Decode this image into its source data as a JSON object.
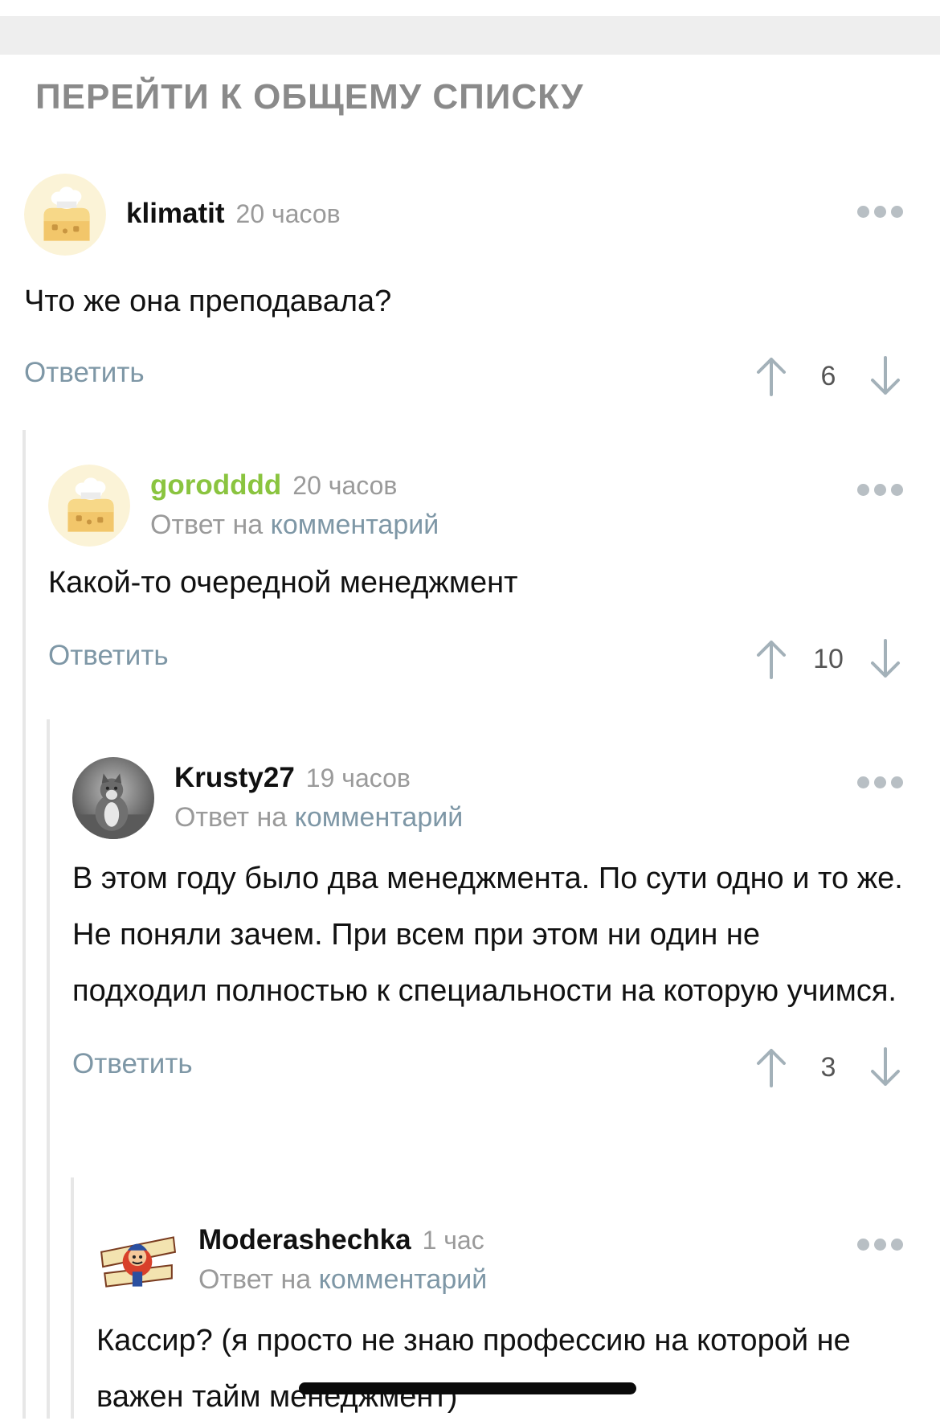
{
  "header": {
    "goto_all": "ПЕРЕЙТИ К ОБЩЕМУ СПИСКУ"
  },
  "comments": [
    {
      "author": "klimatit",
      "author_color": "#111111",
      "time": "20 часов",
      "avatar": "chef-hat-cheese-avatar",
      "text": "Что же она преподавала?",
      "reply_label": "Ответить",
      "rating": "6"
    },
    {
      "author": "gorodddd",
      "author_color": "#8ac43f",
      "time": "20 часов",
      "avatar": "chef-hat-cheese-avatar",
      "reply_to_prefix": "Ответ на",
      "reply_to_link": "комментарий",
      "text": "Какой-то очередной менеджмент",
      "reply_label": "Ответить",
      "rating": "10"
    },
    {
      "author": "Krusty27",
      "author_color": "#111111",
      "time": "19 часов",
      "avatar": "cat-photo-avatar",
      "reply_to_prefix": "Ответ на",
      "reply_to_link": "комментарий",
      "text": "В этом году было два менеджмента. По сути одно и то же. Не поняли зачем. При всем при этом ни один не подходил полностью к специальности на которую учимся.",
      "reply_label": "Ответить",
      "rating": "3"
    },
    {
      "author": "Moderashechka",
      "author_color": "#111111",
      "time": "1 час",
      "avatar": "cartoon-badge-avatar",
      "reply_to_prefix": "Ответ на",
      "reply_to_link": "комментарий",
      "text": "Кассир? (я просто не знаю профессию на которой не важен тайм менеджмент)"
    }
  ],
  "colors": {
    "link": "#7e97a6",
    "muted": "#9a9a9a",
    "thread_line": "#e7e7e7",
    "top_band": "#eeeeee"
  },
  "icons": [
    "more-icon",
    "upvote-arrow-icon",
    "downvote-arrow-icon"
  ]
}
